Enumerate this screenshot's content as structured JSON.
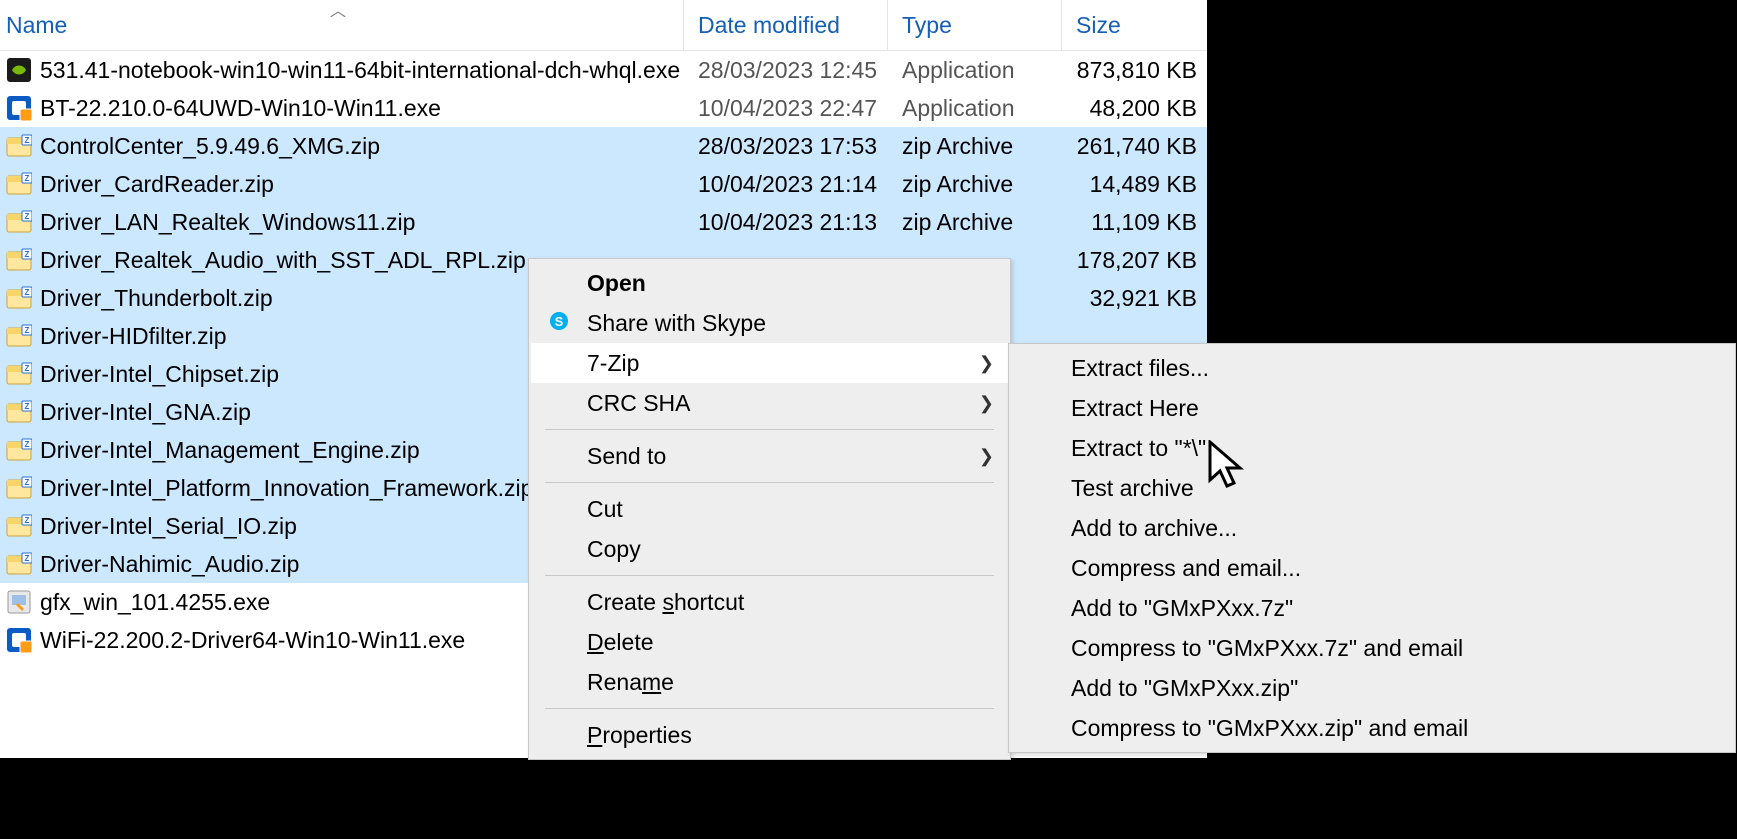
{
  "columns": {
    "name": "Name",
    "date": "Date modified",
    "type": "Type",
    "size": "Size"
  },
  "sort_arrow": "︿",
  "files": [
    {
      "name": "531.41-notebook-win10-win11-64bit-international-dch-whql.exe",
      "date": "28/03/2023 12:45",
      "type": "Application",
      "size": "873,810 KB",
      "selected": false,
      "icon": "nvidia"
    },
    {
      "name": "BT-22.210.0-64UWD-Win10-Win11.exe",
      "date": "10/04/2023 22:47",
      "type": "Application",
      "size": "48,200 KB",
      "selected": false,
      "icon": "intel"
    },
    {
      "name": "ControlCenter_5.9.49.6_XMG.zip",
      "date": "28/03/2023 17:53",
      "type": "zip Archive",
      "size": "261,740 KB",
      "selected": true,
      "icon": "zip"
    },
    {
      "name": "Driver_CardReader.zip",
      "date": "10/04/2023 21:14",
      "type": "zip Archive",
      "size": "14,489 KB",
      "selected": true,
      "icon": "zip"
    },
    {
      "name": "Driver_LAN_Realtek_Windows11.zip",
      "date": "10/04/2023 21:13",
      "type": "zip Archive",
      "size": "11,109 KB",
      "selected": true,
      "icon": "zip"
    },
    {
      "name": "Driver_Realtek_Audio_with_SST_ADL_RPL.zip",
      "date": "",
      "type": "",
      "size": "178,207 KB",
      "selected": true,
      "icon": "zip"
    },
    {
      "name": "Driver_Thunderbolt.zip",
      "date": "",
      "type": "",
      "size": "32,921 KB",
      "selected": true,
      "icon": "zip"
    },
    {
      "name": "Driver-HIDfilter.zip",
      "date": "",
      "type": "",
      "size": "",
      "selected": true,
      "icon": "zip"
    },
    {
      "name": "Driver-Intel_Chipset.zip",
      "date": "",
      "type": "",
      "size": "",
      "selected": true,
      "icon": "zip"
    },
    {
      "name": "Driver-Intel_GNA.zip",
      "date": "",
      "type": "",
      "size": "",
      "selected": true,
      "icon": "zip"
    },
    {
      "name": "Driver-Intel_Management_Engine.zip",
      "date": "",
      "type": "",
      "size": "",
      "selected": true,
      "icon": "zip"
    },
    {
      "name": "Driver-Intel_Platform_Innovation_Framework.zip",
      "date": "",
      "type": "",
      "size": "",
      "selected": true,
      "icon": "zip"
    },
    {
      "name": "Driver-Intel_Serial_IO.zip",
      "date": "",
      "type": "",
      "size": "",
      "selected": true,
      "icon": "zip"
    },
    {
      "name": "Driver-Nahimic_Audio.zip",
      "date": "",
      "type": "",
      "size": "",
      "selected": true,
      "icon": "zip"
    },
    {
      "name": "gfx_win_101.4255.exe",
      "date": "",
      "type": "",
      "size": "",
      "selected": false,
      "icon": "installer"
    },
    {
      "name": "WiFi-22.200.2-Driver64-Win10-Win11.exe",
      "date": "",
      "type": "",
      "size": "",
      "selected": false,
      "icon": "intel"
    }
  ],
  "context_menu": {
    "open": "Open",
    "share_skype": "Share with Skype",
    "seven_zip": "7-Zip",
    "crc_sha": "CRC SHA",
    "send_to": "Send to",
    "cut": "Cut",
    "copy": "Copy",
    "create_shortcut_pre": "Create ",
    "create_shortcut_u": "s",
    "create_shortcut_post": "hortcut",
    "delete_u": "D",
    "delete_post": "elete",
    "rename_pre": "Rena",
    "rename_u": "m",
    "rename_post": "e",
    "properties_u": "P",
    "properties_post": "roperties"
  },
  "submenu": {
    "extract_files": "Extract files...",
    "extract_here": "Extract Here",
    "extract_to": "Extract to \"*\\\"",
    "test_archive": "Test archive",
    "add_to_archive": "Add to archive...",
    "compress_email": "Compress and email...",
    "add_7z": "Add to \"GMxPXxx.7z\"",
    "compress_7z_email": "Compress to \"GMxPXxx.7z\" and email",
    "add_zip": "Add to \"GMxPXxx.zip\"",
    "compress_zip_email": "Compress to \"GMxPXxx.zip\" and email"
  }
}
